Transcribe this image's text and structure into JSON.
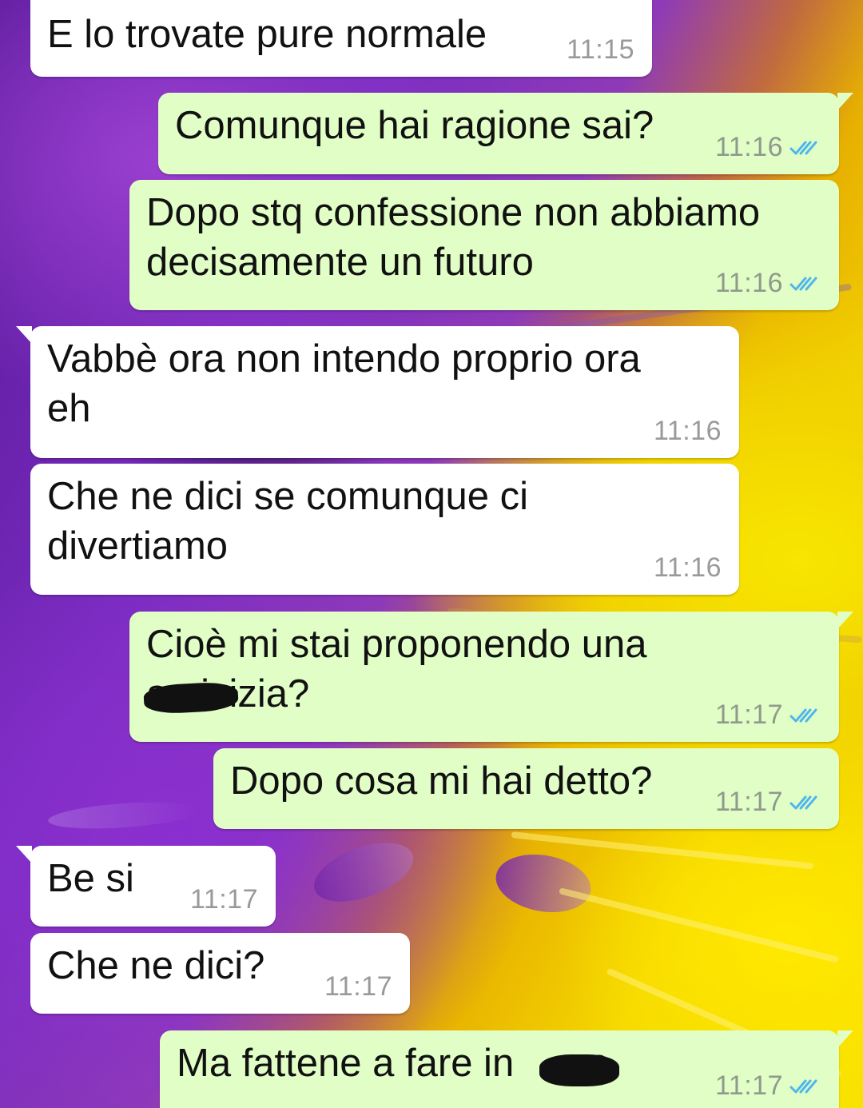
{
  "chat": {
    "messages": [
      {
        "direction": "in",
        "text": "E lo trovate pure normale",
        "time": "11:15"
      },
      {
        "direction": "out",
        "text": "Comunque hai ragione sai?",
        "time": "11:16",
        "status": "read"
      },
      {
        "direction": "out",
        "text": "Dopo stq confessione non abbiamo decisamente un futuro",
        "time": "11:16",
        "status": "read"
      },
      {
        "direction": "in",
        "text": "Vabbè ora non intendo proprio ora eh",
        "time": "11:16"
      },
      {
        "direction": "in",
        "text": "Che ne dici se comunque ci divertiamo",
        "time": "11:16"
      },
      {
        "direction": "out",
        "text": "Cioè mi stai proponendo una amicizia?",
        "time": "11:17",
        "status": "read"
      },
      {
        "direction": "out",
        "text": "Dopo cosa mi hai detto?",
        "time": "11:17",
        "status": "read"
      },
      {
        "direction": "in",
        "text": "Be si",
        "time": "11:17"
      },
      {
        "direction": "in",
        "text": "Che ne dici?",
        "time": "11:17"
      },
      {
        "direction": "out",
        "text": "Ma fattene a fare in     va",
        "time": "11:17",
        "status": "read"
      }
    ]
  },
  "colors": {
    "incoming_bubble": "#ffffff",
    "outgoing_bubble": "#e1fec6",
    "read_ticks": "#4fb6ec",
    "background_primary": "#7a2cc0",
    "background_secondary": "#f5d800"
  },
  "icons": {
    "read_receipt": "double-check-icon"
  }
}
